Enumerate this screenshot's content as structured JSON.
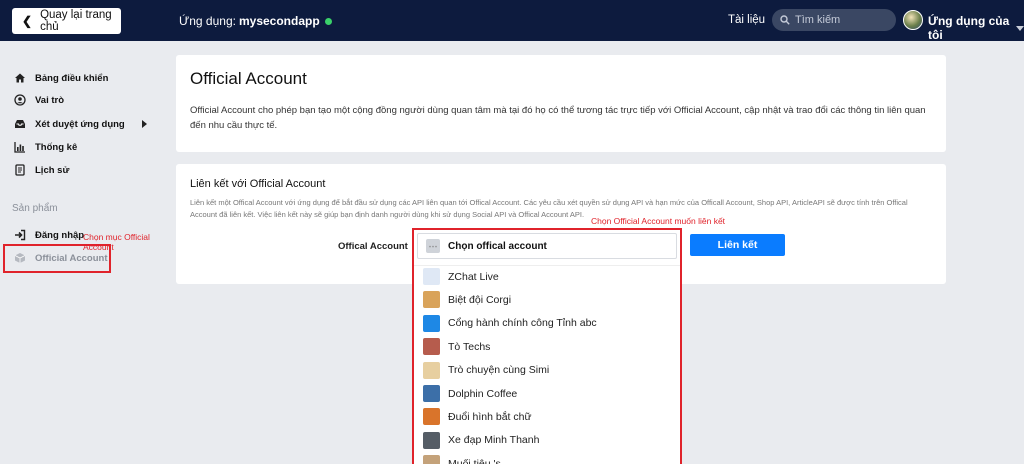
{
  "header": {
    "back_label": "Quay lại trang chủ",
    "app_prefix": "Ứng dụng:",
    "app_name": "mysecondapp",
    "docs_label": "Tài liệu",
    "search_placeholder": "Tìm kiếm",
    "user_menu_label": "Ứng dụng của tôi"
  },
  "sidebar": {
    "items": [
      {
        "label": "Bảng điều khiển",
        "icon": "home-icon"
      },
      {
        "label": "Vai trò",
        "icon": "user-circle-icon"
      },
      {
        "label": "Xét duyệt ứng dụng",
        "icon": "inbox-icon"
      },
      {
        "label": "Thống kê",
        "icon": "bar-chart-icon"
      },
      {
        "label": "Lịch sử",
        "icon": "history-icon"
      }
    ],
    "section_label": "Sản phẩm",
    "products": [
      {
        "label": "Đăng nhập",
        "icon": "sign-in-icon"
      },
      {
        "label": "Official Account",
        "icon": "cube-icon"
      }
    ]
  },
  "annotations": {
    "sidebar_hint": "Chọn mục Official Account",
    "dropdown_hint": "Chọn Official Account muốn liên kết"
  },
  "oa_card": {
    "title": "Official Account",
    "description": "Official Account cho phép bạn tạo một cộng đồng người dùng quan tâm mà tại đó họ có thể tương tác trực tiếp với Official Account, cập nhật và trao đổi các thông tin liên quan đến nhu cầu thực tế."
  },
  "link_card": {
    "title": "Liên kết với Official Account",
    "description": "Liên kết một Offical Account với ứng dụng để bắt đầu sử dụng các API liên quan tới Offical Account. Các yêu cầu xét quyền sử dụng API và hạn mức của Officall Account, Shop API, ArticleAPI sẽ được tính trên Offical Account đã liên kết. Việc liên kết này sẽ giúp bạn định danh người dùng khi sử dụng Social API và Offical Account API.",
    "field_label": "Offical Account",
    "button_label": "Liên kết"
  },
  "dropdown": {
    "placeholder": "Chọn offical account",
    "options": [
      {
        "label": "ZChat Live",
        "color": "#dfe8f5"
      },
      {
        "label": "Biệt đội Corgi",
        "color": "#d9a35a"
      },
      {
        "label": "Cổng hành chính công Tỉnh abc",
        "color": "#1e88e5"
      },
      {
        "label": "Tò Techs",
        "color": "#b65c4d"
      },
      {
        "label": "Trò chuyện cùng Simi",
        "color": "#e7cfa0"
      },
      {
        "label": "Dolphin Coffee",
        "color": "#3c6fa8"
      },
      {
        "label": "Đuổi hình bắt chữ",
        "color": "#d9742b"
      },
      {
        "label": "Xe đạp Minh Thanh",
        "color": "#555d66"
      },
      {
        "label": "Muối tiêu 's",
        "color": "#c4a27a"
      }
    ]
  }
}
